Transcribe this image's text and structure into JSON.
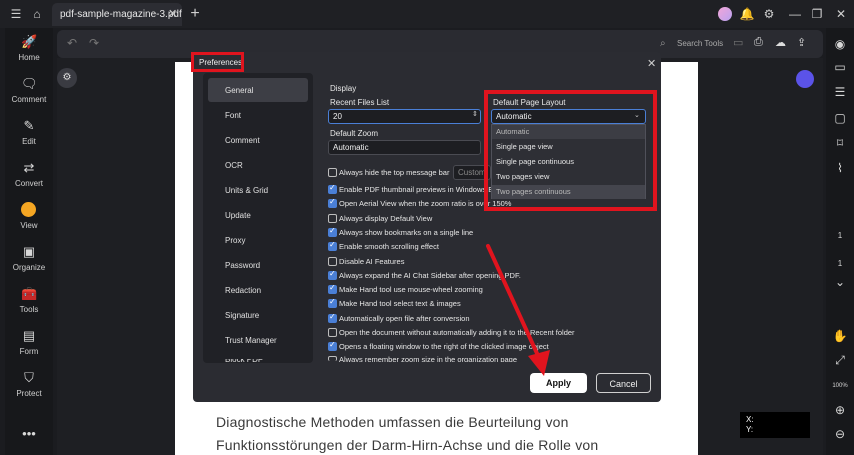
{
  "window": {
    "tab_title": "pdf-sample-magazine-3.pdf"
  },
  "toolbar": {
    "search_placeholder": "Search Tools"
  },
  "sidebar": {
    "items": [
      {
        "label": "Home",
        "icon": "rocket-icon"
      },
      {
        "label": "Comment",
        "icon": "comment-icon"
      },
      {
        "label": "Edit",
        "icon": "edit-icon"
      },
      {
        "label": "Convert",
        "icon": "convert-icon"
      },
      {
        "label": "View",
        "icon": "view-icon"
      },
      {
        "label": "Organize",
        "icon": "organize-icon"
      },
      {
        "label": "Tools",
        "icon": "tools-icon"
      },
      {
        "label": "Form",
        "icon": "form-icon"
      },
      {
        "label": "Protect",
        "icon": "protect-icon"
      }
    ]
  },
  "dialog": {
    "title": "Preferences",
    "nav": [
      "General",
      "Font",
      "Comment",
      "OCR",
      "Units & Grid",
      "Update",
      "Proxy",
      "Password",
      "Redaction",
      "Signature",
      "Trust Manager",
      "Block PDF"
    ],
    "section": "Display",
    "recent_files_label": "Recent Files List",
    "recent_files_value": "20",
    "default_zoom_label": "Default Zoom",
    "default_zoom_value": "Automatic",
    "page_layout_label": "Default Page Layout",
    "page_layout_value": "Automatic",
    "page_layout_options": [
      "Automatic",
      "Single page view",
      "Single page continuous",
      "Two pages view",
      "Two pages continuous"
    ],
    "customize_label": "Custom",
    "checkboxes": [
      {
        "label": "Always hide the top message bar",
        "checked": false
      },
      {
        "label": "Enable PDF thumbnail previews in Windows E",
        "checked": true
      },
      {
        "label": "Open Aerial View when the zoom ratio is over 150%",
        "checked": true
      },
      {
        "label": "Always display Default View",
        "checked": false
      },
      {
        "label": "Always show bookmarks on a single line",
        "checked": true
      },
      {
        "label": "Enable smooth scrolling effect",
        "checked": true
      },
      {
        "label": "Disable AI Features",
        "checked": false
      },
      {
        "label": "Always expand the AI Chat Sidebar after opening PDF.",
        "checked": true
      },
      {
        "label": "Make Hand tool use mouse-wheel zooming",
        "checked": true
      },
      {
        "label": "Make Hand tool select text & images",
        "checked": true
      },
      {
        "label": "Automatically open file after conversion",
        "checked": true
      },
      {
        "label": "Open the document without automatically adding it to the Recent folder",
        "checked": false
      },
      {
        "label": "Opens a floating window to the right of the clicked image object",
        "checked": true
      },
      {
        "label": "Always remember zoom size in the organization page",
        "checked": false
      }
    ],
    "apply_label": "Apply",
    "cancel_label": "Cancel"
  },
  "document": {
    "lines": [
      "Diagnostische Methoden umfassen die Beurteilung von",
      "Funktionsstörungen der Darm-Hirn-Achse und die Rolle von"
    ]
  },
  "right_panel": {
    "page_current": "1",
    "page_total": "1",
    "zoom": "100%"
  },
  "coords": {
    "x_label": "X:",
    "y_label": "Y:"
  },
  "colors": {
    "accent": "#4a7fd6",
    "highlight_box": "#e0141e",
    "ai_button": "#5b53e8"
  }
}
